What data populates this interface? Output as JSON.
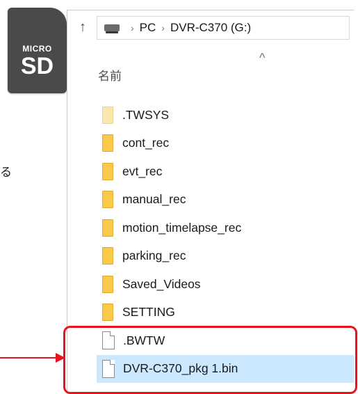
{
  "sd_card": {
    "micro_label": "MICRO",
    "sd_label": "SD"
  },
  "side_text": "る",
  "explorer": {
    "breadcrumb": [
      "PC",
      "DVR-C370 (G:)"
    ],
    "column_header": "名前",
    "items": [
      {
        "name": ".TWSYS",
        "type": "folder",
        "hidden": true
      },
      {
        "name": "cont_rec",
        "type": "folder"
      },
      {
        "name": "evt_rec",
        "type": "folder"
      },
      {
        "name": "manual_rec",
        "type": "folder"
      },
      {
        "name": "motion_timelapse_rec",
        "type": "folder"
      },
      {
        "name": "parking_rec",
        "type": "folder"
      },
      {
        "name": "Saved_Videos",
        "type": "folder"
      },
      {
        "name": "SETTING",
        "type": "folder"
      },
      {
        "name": ".BWTW",
        "type": "file"
      },
      {
        "name": "DVR-C370_pkg 1.bin",
        "type": "file",
        "selected": true
      }
    ]
  },
  "colors": {
    "highlight": "#e8141d",
    "selection": "#cce8ff",
    "folder": "#f8c94a"
  }
}
